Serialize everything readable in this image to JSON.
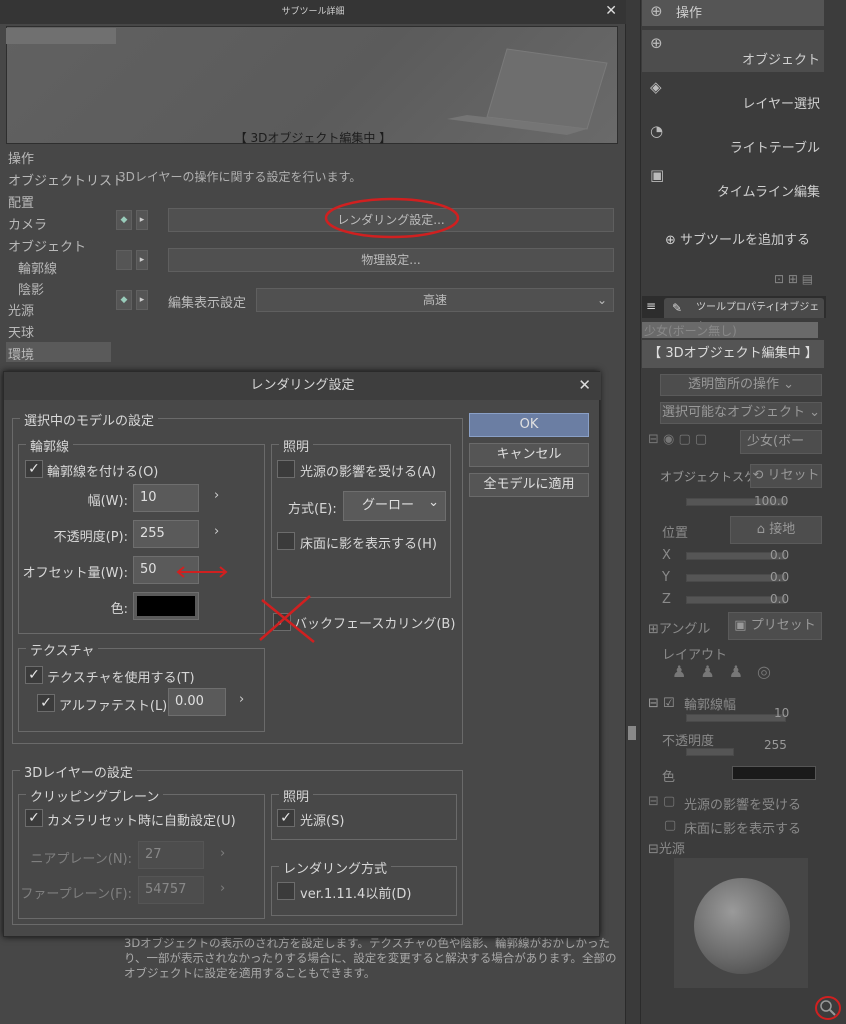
{
  "subtool_window": {
    "title": "サブツール詳細",
    "close": "✕",
    "preview_caption": "【 3Dオブジェクト編集中 】",
    "categories": [
      "操作",
      "オブジェクトリスト",
      "配置",
      "カメラ",
      "オブジェクト",
      "輪郭線",
      "陰影",
      "光源",
      "天球",
      "環境"
    ],
    "description": "3Dレイヤーの操作に関する設定を行います。",
    "rendering_btn": "レンダリング設定...",
    "physics_btn": "物理設定...",
    "edit_display_label": "編集表示設定",
    "edit_display_value": "高速",
    "bottom_desc": "3Dオブジェクトの表示のされ方を設定します。テクスチャの色や陰影、輪郭線がおかしかったり、一部が表示されなかったりする場合に、設定を変更すると解決する場合があります。全部のオブジェクトに設定を適用することもできます。"
  },
  "right_panel": {
    "tools": [
      "操作",
      "オブジェクト",
      "レイヤー選択",
      "ライトテーブル",
      "タイムライン編集"
    ],
    "add_subtool": "サブツールを追加する",
    "tool_property_tab": "ツールプロパティ[オブジェクト]",
    "model_name": "少女(ボーン無し)",
    "edit_status": "【 3Dオブジェクト編集中 】",
    "transparent_op": "透明箇所の操作",
    "selectable_obj": "選択可能なオブジェクト",
    "object_name": "少女(ボー",
    "object_scale": "オブジェクトスケール",
    "reset": "リセット",
    "scale_value": "100.0",
    "position": "位置",
    "ground": "接地",
    "x": "X",
    "y": "Y",
    "z": "Z",
    "xv": "0.0",
    "yv": "0.0",
    "zv": "0.0",
    "angle": "アングル",
    "preset": "プリセット",
    "layout": "レイアウト",
    "outline_width": "輪郭線幅",
    "outline_width_v": "10",
    "opacity": "不透明度",
    "opacity_v": "255",
    "color": "色",
    "receive_light": "光源の影響を受ける",
    "floor_shadow": "床面に影を表示する",
    "light": "光源"
  },
  "dialog": {
    "title": "レンダリング設定",
    "close": "✕",
    "model_group": "選択中のモデルの設定",
    "outline_group": "輪郭線",
    "apply_outline": "輪郭線を付ける(O)",
    "width_label": "幅(W):",
    "width_value": "10",
    "opacity_label": "不透明度(P):",
    "opacity_value": "255",
    "offset_label": "オフセット量(W):",
    "offset_value": "50",
    "color_label": "色:",
    "lighting_group": "照明",
    "receive_light": "光源の影響を受ける(A)",
    "method_label": "方式(E):",
    "method_value": "グーロー",
    "floor_shadow": "床面に影を表示する(H)",
    "backface": "バックフェースカリング(B)",
    "texture_group": "テクスチャ",
    "use_texture": "テクスチャを使用する(T)",
    "alpha_test": "アルファテスト(L)",
    "alpha_value": "0.00",
    "layer_group": "3Dレイヤーの設定",
    "clipping_group": "クリッピングプレーン",
    "auto_camera": "カメラリセット時に自動設定(U)",
    "near_label": "ニアプレーン(N):",
    "near_value": "27",
    "far_label": "ファープレーン(F):",
    "far_value": "54757",
    "lighting2_group": "照明",
    "light_source": "光源(S)",
    "render_method_group": "レンダリング方式",
    "legacy": "ver.1.11.4以前(D)",
    "ok": "OK",
    "cancel": "キャンセル",
    "apply_all": "全モデルに適用",
    "check": "✓",
    "arrow": "›"
  },
  "colors": {
    "annotation_red": "#d02020",
    "ok_button": "#6b7ea3"
  }
}
